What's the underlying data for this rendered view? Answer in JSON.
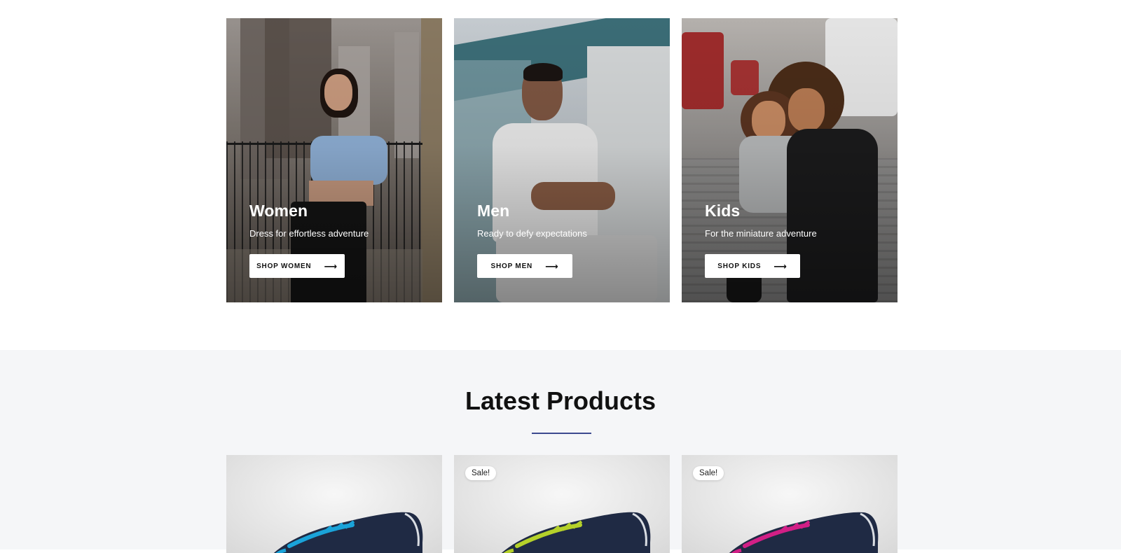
{
  "categories": [
    {
      "title": "Women",
      "subtitle": "Dress for effortless adventure",
      "button_label": "SHOP WOMEN",
      "button_icon": "arrow-right-icon",
      "image": "woman-on-balcony-photo"
    },
    {
      "title": "Men",
      "subtitle": "Ready to defy expectations",
      "button_label": "SHOP MEN",
      "button_icon": "arrow-right-icon",
      "image": "man-in-white-shirt-photo"
    },
    {
      "title": "Kids",
      "subtitle": "For the miniature adventure",
      "button_label": "SHOP KIDS",
      "button_icon": "arrow-right-icon",
      "image": "mother-and-child-photo"
    }
  ],
  "latest_products": {
    "title": "Latest Products",
    "accent_color": "#3d4a8f",
    "items": [
      {
        "badge": "",
        "image": "sneaker-blue-accent-photo",
        "accent": "#1aa3d9"
      },
      {
        "badge": "Sale!",
        "image": "sneaker-lime-accent-photo",
        "accent": "#b5d12a"
      },
      {
        "badge": "Sale!",
        "image": "sneaker-magenta-accent-photo",
        "accent": "#d21f86"
      }
    ]
  }
}
